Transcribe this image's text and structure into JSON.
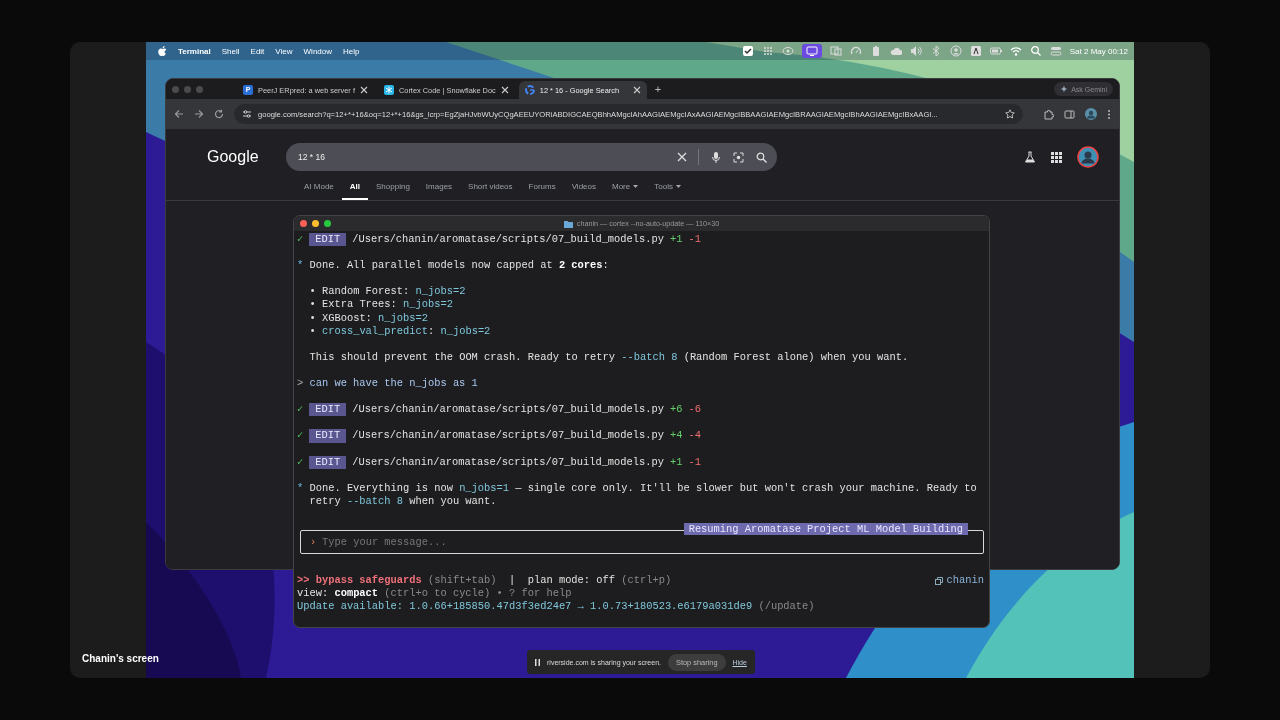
{
  "recording": {
    "screen_label": "Chanin's screen"
  },
  "menu_bar": {
    "app": "Terminal",
    "items": [
      "Shell",
      "Edit",
      "View",
      "Window",
      "Help"
    ],
    "clock": "Sat 2 May  00:12"
  },
  "browser": {
    "tabs": [
      {
        "title": "PeerJ ERpred: a web server f",
        "favicon": {
          "kind": "letter",
          "text": "P"
        },
        "selected": false
      },
      {
        "title": "Cortex Code | Snowflake Doc",
        "favicon": {
          "kind": "flake"
        },
        "selected": false
      },
      {
        "title": "12 * 16 - Google Search",
        "favicon": {
          "kind": "google"
        },
        "selected": true
      }
    ],
    "new_tab": "+",
    "ask_button": "Ask Gemini",
    "address": "google.com/search?q=12+*+16&oq=12+*+16&gs_lcrp=EgZjaHJvbWUyCQgAEEUYORiABDIGCAEQBhhAMgcIAhAAGIAEMgcIAxAAGIAEMgcIBBAAGIAEMgcIBRAAGIAEMgcIBhAAGIAEMgcIBxAAGI...",
    "page": {
      "logo": "Google",
      "query": "12 * 16",
      "tabs": [
        {
          "label": "AI Mode",
          "selected": false
        },
        {
          "label": "All",
          "selected": true
        },
        {
          "label": "Shopping",
          "selected": false
        },
        {
          "label": "Images",
          "selected": false
        },
        {
          "label": "Short videos",
          "selected": false
        },
        {
          "label": "Forums",
          "selected": false
        },
        {
          "label": "Videos",
          "selected": false
        },
        {
          "label": "More",
          "selected": false,
          "menu": true
        },
        {
          "label": "Tools",
          "selected": false,
          "menu": true
        }
      ]
    }
  },
  "terminal": {
    "title": "chanin — cortex --no-auto-update — 110×30",
    "blocks": [
      {
        "kind": "edit",
        "mark": "✓",
        "tag": "EDIT",
        "path": "/Users/chanin/aromatase/scripts/07_build_models.py",
        "added": "+1",
        "removed": "-1"
      },
      {
        "kind": "message",
        "marker": "*",
        "segments": [
          {
            "kind": "plain",
            "text": "Done. All parallel models now capped at "
          },
          {
            "kind": "bold",
            "text": "2 cores"
          },
          {
            "kind": "plain",
            "text": ":"
          }
        ]
      },
      {
        "kind": "bullets",
        "items": [
          {
            "marker": "•",
            "segments": [
              {
                "kind": "plain",
                "text": "Random Forest: "
              },
              {
                "kind": "code",
                "text": "n_jobs=2"
              }
            ]
          },
          {
            "marker": "•",
            "segments": [
              {
                "kind": "plain",
                "text": "Extra Trees: "
              },
              {
                "kind": "code",
                "text": "n_jobs=2"
              }
            ]
          },
          {
            "marker": "•",
            "segments": [
              {
                "kind": "plain",
                "text": "XGBoost: "
              },
              {
                "kind": "code",
                "text": "n_jobs=2"
              }
            ]
          },
          {
            "marker": "•",
            "segments": [
              {
                "kind": "code",
                "text": "cross_val_predict"
              },
              {
                "kind": "plain",
                "text": ": "
              },
              {
                "kind": "code",
                "text": "n_jobs=2"
              }
            ]
          }
        ]
      },
      {
        "kind": "text",
        "segments": [
          {
            "kind": "plain",
            "text": "This should prevent the OOM crash. Ready to retry "
          },
          {
            "kind": "code",
            "text": "--batch 8"
          },
          {
            "kind": "plain",
            "text": " (Random Forest alone) when you want."
          }
        ]
      },
      {
        "kind": "prompt",
        "marker": ">",
        "text": "can we have the n_jobs as 1"
      },
      {
        "kind": "edit",
        "mark": "✓",
        "tag": "EDIT",
        "path": "/Users/chanin/aromatase/scripts/07_build_models.py",
        "added": "+6",
        "removed": "-6"
      },
      {
        "kind": "edit",
        "mark": "✓",
        "tag": "EDIT",
        "path": "/Users/chanin/aromatase/scripts/07_build_models.py",
        "added": "+4",
        "removed": "-4"
      },
      {
        "kind": "edit",
        "mark": "✓",
        "tag": "EDIT",
        "path": "/Users/chanin/aromatase/scripts/07_build_models.py",
        "added": "+1",
        "removed": "-1"
      },
      {
        "kind": "message",
        "marker": "*",
        "segments": [
          {
            "kind": "plain",
            "text": "Done. Everything is now "
          },
          {
            "kind": "code",
            "text": "n_jobs=1"
          },
          {
            "kind": "plain",
            "text": " — single core only. It'll be slower but won't crash your machine. Ready to retry "
          },
          {
            "kind": "code",
            "text": "--batch 8"
          },
          {
            "kind": "plain",
            "text": " when you want."
          }
        ]
      }
    ],
    "input": {
      "prompt": "›",
      "placeholder": "Type your message...",
      "session": "Resuming Aromatase Project ML Model Building"
    },
    "status_lines": [
      {
        "segments": [
          {
            "kind": "alert",
            "text": ">> bypass safeguards"
          },
          {
            "kind": "dim",
            "text": " (shift+tab)"
          },
          {
            "kind": "plain",
            "text": "  |  plan mode: off"
          },
          {
            "kind": "dim",
            "text": " (ctrl+p)"
          }
        ]
      },
      {
        "segments": [
          {
            "kind": "plain",
            "text": "view: "
          },
          {
            "kind": "bold",
            "text": "compact"
          },
          {
            "kind": "dim",
            "text": " (ctrl+o to cycle) • ? for help"
          }
        ]
      },
      {
        "segments": [
          {
            "kind": "code",
            "text": "Update available: 1.0.66+185850.47d3f3ed24e7 → 1.0.73+180523.e6179a031de9"
          },
          {
            "kind": "dim",
            "text": " (/update)"
          }
        ]
      }
    ],
    "user": "chanin"
  },
  "share_bar": {
    "message": "riverside.com is sharing your screen.",
    "stop_button": "Stop sharing",
    "hide_link": "Hide"
  }
}
